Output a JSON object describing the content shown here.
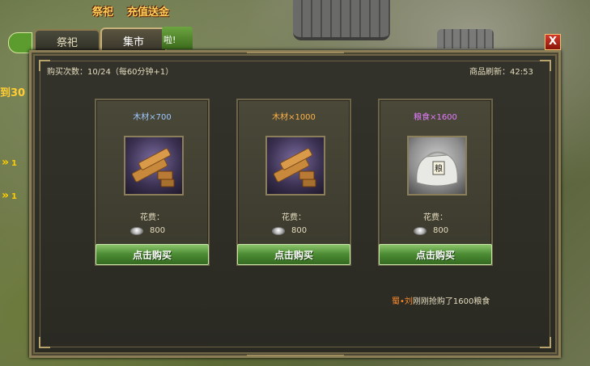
{
  "background": {
    "top_left_text": "祭祀",
    "top_mid_text": "充值送金",
    "side_text": "到30",
    "side_arrows": [
      "1",
      "1"
    ]
  },
  "tabs": [
    {
      "label": "祭祀",
      "active": false
    },
    {
      "label": "集市",
      "active": true
    }
  ],
  "tab_green_text": "啦!",
  "close_label": "X",
  "header": {
    "purchase_info": "购买次数：10/24（每60分钟+1）",
    "refresh_info": "商品刷新：42:53"
  },
  "items": [
    {
      "name": "木材×700",
      "name_color": "#9ec8ff",
      "image": "wood-icon",
      "cost_label": "花费：",
      "cost": "800",
      "buy_label": "点击购买"
    },
    {
      "name": "木材×1000",
      "name_color": "#ffb347",
      "image": "wood-icon",
      "cost_label": "花费：",
      "cost": "800",
      "buy_label": "点击购买"
    },
    {
      "name": "粮食×1600",
      "name_color": "#e37cff",
      "image": "grain-sack-icon",
      "cost_label": "花费：",
      "cost": "800",
      "buy_label": "点击购买"
    }
  ],
  "notice": {
    "player": "蜀•刘",
    "message": "刚刚抢购了1600粮食"
  }
}
